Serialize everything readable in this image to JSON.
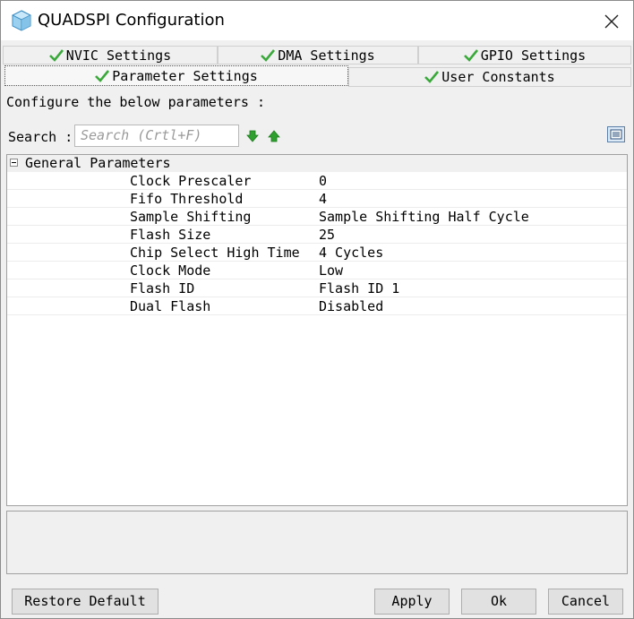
{
  "window": {
    "title": "QUADSPI Configuration"
  },
  "icons": {
    "app": "cube-icon",
    "close": "close-icon",
    "tab_check": "checkmark-icon",
    "find_next": "arrow-down-icon",
    "find_prev": "arrow-up-icon",
    "view_toggle": "list-view-icon"
  },
  "colors": {
    "check_green": "#3aa83a",
    "arrow_green": "#2fa02f",
    "title_bg": "#ffffff",
    "dialog_bg": "#f0f0f0"
  },
  "tabs": [
    {
      "label": "NVIC Settings"
    },
    {
      "label": "DMA Settings"
    },
    {
      "label": "GPIO Settings"
    },
    {
      "label": "Parameter Settings"
    },
    {
      "label": "User Constants"
    }
  ],
  "configure_text": "Configure the below parameters :",
  "search": {
    "label": "Search :",
    "placeholder": "Search (Crtl+F)"
  },
  "group": {
    "title": "General Parameters"
  },
  "parameters": [
    {
      "name": "Clock Prescaler",
      "value": "0"
    },
    {
      "name": "Fifo Threshold",
      "value": "4"
    },
    {
      "name": "Sample Shifting",
      "value": "Sample Shifting Half Cycle"
    },
    {
      "name": "Flash Size",
      "value": "25"
    },
    {
      "name": "Chip Select High Time",
      "value": "4 Cycles"
    },
    {
      "name": "Clock Mode",
      "value": "Low"
    },
    {
      "name": "Flash ID",
      "value": "Flash ID 1"
    },
    {
      "name": "Dual Flash",
      "value": "Disabled"
    }
  ],
  "buttons": {
    "restore": "Restore Default",
    "apply": "Apply",
    "ok": "Ok",
    "cancel": "Cancel"
  }
}
